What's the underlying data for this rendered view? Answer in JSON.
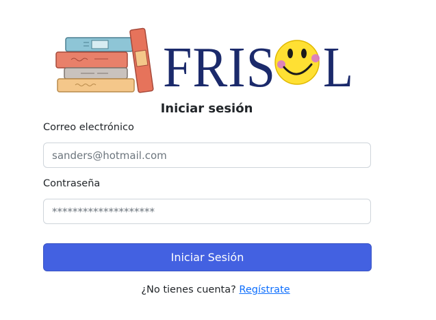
{
  "brand": {
    "logo_text": "FRISOL",
    "colors": {
      "brand_navy": "#1b2a6b",
      "smiley_yellow": "#ffe033",
      "primary_button": "#4361e1",
      "link": "#0d6efd"
    }
  },
  "login": {
    "title": "Iniciar sesión",
    "email_label": "Correo electrónico",
    "email_value": "sanders@hotmail.com",
    "password_label": "Contraseña",
    "password_value": "********************",
    "submit_label": "Iniciar Sesión",
    "signup_prompt": "¿No tienes cuenta?",
    "signup_link": "Regístrate"
  }
}
